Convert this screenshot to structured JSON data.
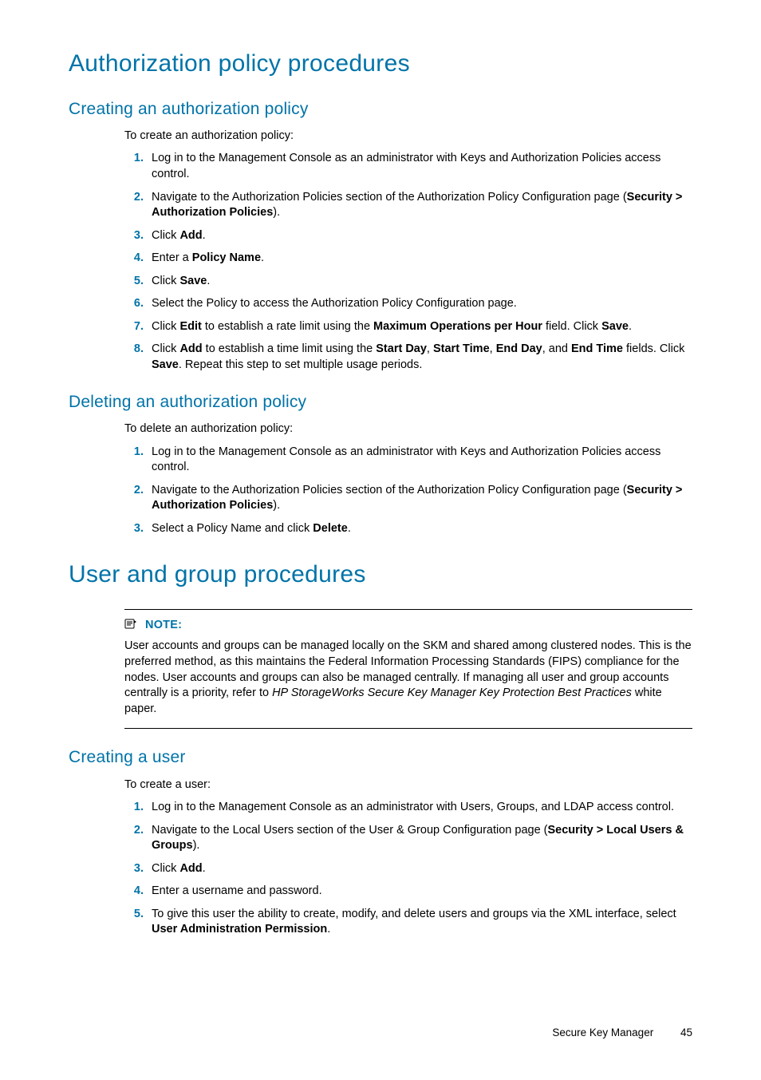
{
  "h1a": "Authorization policy procedures",
  "sec1": {
    "title": "Creating an authorization policy",
    "intro": "To create an authorization policy:",
    "items": [
      {
        "segs": [
          {
            "t": "Log in to the Management Console as an administrator with Keys and Authorization Policies access control."
          }
        ]
      },
      {
        "segs": [
          {
            "t": "Navigate to the Authorization Policies section of the Authorization Policy Configuration page ("
          },
          {
            "t": "Security > Authorization Policies",
            "b": true
          },
          {
            "t": ")."
          }
        ]
      },
      {
        "segs": [
          {
            "t": "Click "
          },
          {
            "t": "Add",
            "b": true
          },
          {
            "t": "."
          }
        ]
      },
      {
        "segs": [
          {
            "t": "Enter a "
          },
          {
            "t": "Policy Name",
            "b": true
          },
          {
            "t": "."
          }
        ]
      },
      {
        "segs": [
          {
            "t": "Click "
          },
          {
            "t": "Save",
            "b": true
          },
          {
            "t": "."
          }
        ]
      },
      {
        "segs": [
          {
            "t": "Select the Policy to access the Authorization Policy Configuration page."
          }
        ]
      },
      {
        "segs": [
          {
            "t": "Click "
          },
          {
            "t": "Edit",
            "b": true
          },
          {
            "t": " to establish a rate limit using the "
          },
          {
            "t": "Maximum Operations per Hour",
            "b": true
          },
          {
            "t": " field. Click "
          },
          {
            "t": "Save",
            "b": true
          },
          {
            "t": "."
          }
        ]
      },
      {
        "segs": [
          {
            "t": "Click "
          },
          {
            "t": "Add",
            "b": true
          },
          {
            "t": " to establish a time limit using the "
          },
          {
            "t": "Start Day",
            "b": true
          },
          {
            "t": ", "
          },
          {
            "t": "Start Time",
            "b": true
          },
          {
            "t": ", "
          },
          {
            "t": "End Day",
            "b": true
          },
          {
            "t": ", and "
          },
          {
            "t": "End Time",
            "b": true
          },
          {
            "t": " fields. Click "
          },
          {
            "t": "Save",
            "b": true
          },
          {
            "t": ". Repeat this step to set multiple usage periods."
          }
        ]
      }
    ]
  },
  "sec2": {
    "title": "Deleting an authorization policy",
    "intro": "To delete an authorization policy:",
    "items": [
      {
        "segs": [
          {
            "t": "Log in to the Management Console as an administrator with Keys and Authorization Policies access control."
          }
        ]
      },
      {
        "segs": [
          {
            "t": "Navigate to the Authorization Policies section of the Authorization Policy Configuration page ("
          },
          {
            "t": "Security > Authorization Policies",
            "b": true
          },
          {
            "t": ")."
          }
        ]
      },
      {
        "segs": [
          {
            "t": "Select a Policy Name and click "
          },
          {
            "t": "Delete",
            "b": true
          },
          {
            "t": "."
          }
        ]
      }
    ]
  },
  "h1b": "User and group procedures",
  "note": {
    "label": "NOTE:",
    "segs": [
      {
        "t": "User accounts and groups can be managed locally on the SKM and shared among clustered nodes. This is the preferred method, as this maintains the Federal Information Processing Standards (FIPS) compliance for the nodes. User accounts and groups can also be managed centrally. If managing all user and group accounts centrally is a priority, refer to "
      },
      {
        "t": "HP StorageWorks Secure Key Manager Key Protection Best Practices",
        "i": true
      },
      {
        "t": " white paper."
      }
    ]
  },
  "sec3": {
    "title": "Creating a user",
    "intro": "To create a user:",
    "items": [
      {
        "segs": [
          {
            "t": "Log in to the Management Console as an administrator with Users, Groups, and LDAP access control."
          }
        ]
      },
      {
        "segs": [
          {
            "t": "Navigate to the Local Users section of the User & Group Configuration page ("
          },
          {
            "t": "Security > Local Users & Groups",
            "b": true
          },
          {
            "t": ")."
          }
        ]
      },
      {
        "segs": [
          {
            "t": "Click "
          },
          {
            "t": "Add",
            "b": true
          },
          {
            "t": "."
          }
        ]
      },
      {
        "segs": [
          {
            "t": "Enter a username and password."
          }
        ]
      },
      {
        "segs": [
          {
            "t": "To give this user the ability to create, modify, and delete users and groups via the XML interface, select "
          },
          {
            "t": "User Administration Permission",
            "b": true
          },
          {
            "t": "."
          }
        ]
      }
    ]
  },
  "footer": {
    "doc": "Secure Key Manager",
    "page": "45"
  }
}
